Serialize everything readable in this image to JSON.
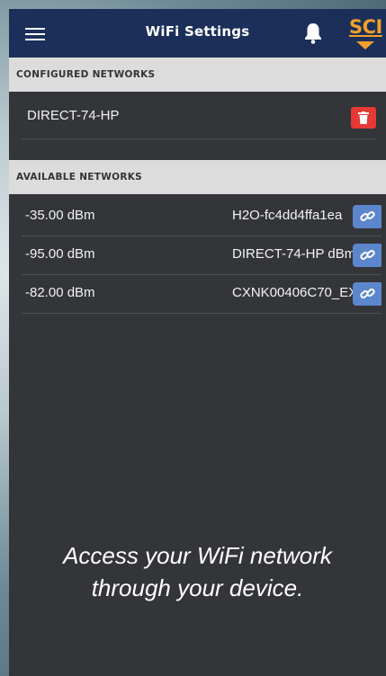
{
  "header": {
    "title": "WiFi Settings",
    "logo_text": "SCI"
  },
  "configured": {
    "heading": "CONFIGURED NETWORKS",
    "networks": [
      {
        "name": "DIRECT-74-HP"
      }
    ]
  },
  "available": {
    "heading": "AVAILABLE NETWORKS",
    "networks": [
      {
        "signal": "-35.00 dBm",
        "ssid": "H2O-fc4dd4ffa1ea"
      },
      {
        "signal": "-95.00 dBm",
        "ssid": "DIRECT-74-HP dBm"
      },
      {
        "signal": "-82.00 dBm",
        "ssid": "CXNK00406C70_EXT"
      }
    ]
  },
  "caption": {
    "line1": "Access your WiFi network",
    "line2": "through your device."
  },
  "colors": {
    "header_bg": "#1b2f5a",
    "logo": "#f2a02a",
    "delete": "#e53935",
    "connect": "#5d87cc"
  },
  "icons": [
    "hamburger-menu-icon",
    "bell-icon",
    "trash-icon",
    "link-icon"
  ]
}
